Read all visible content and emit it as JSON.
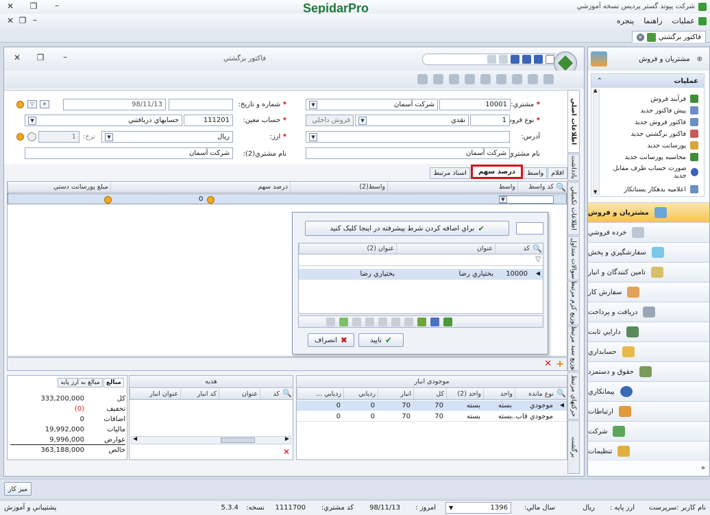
{
  "app": {
    "title": "شرکت پيوند گستر پرديس نسخه آموزشي",
    "brand": "SepidarPro",
    "brand_color": "#1d7a3a"
  },
  "menu": {
    "items": [
      "عمليات",
      "راهنما",
      "پنجره"
    ]
  },
  "doc_tab": {
    "label": "فاکتور برگشتي"
  },
  "window": {
    "title": "فاکتور برگشتي"
  },
  "form": {
    "customer": {
      "label": "مشتري:",
      "code": "10001",
      "name": "شرکت آسمان"
    },
    "number_date": {
      "label": "شماره و تاريخ:",
      "date": "98/11/13",
      "number": ""
    },
    "sale_type": {
      "label": "نوع فروش:",
      "code": "1",
      "value": "نقدي",
      "secondary": "فروش داخلي"
    },
    "account": {
      "label": "حساب معين:",
      "code": "111201",
      "name": "حسابهاي دريافتني"
    },
    "address": {
      "label": "آدرس:",
      "value": ""
    },
    "currency": {
      "label": "ارز:",
      "value": "ريال",
      "rate_label": "نرخ:",
      "rate": "1"
    },
    "customer_name": {
      "label": "نام مشتري:",
      "value": "شرکت آسمان"
    },
    "customer_name2": {
      "label": "نام مشتري(2):",
      "value": "شرکت آسمان"
    }
  },
  "vtabs": [
    "اطلاعات اصلي",
    "يادداشت",
    "اطلاعات تکميلي",
    "سوالات متداول",
    "توزيع کرم مرتبط",
    "توزيع سبد مرتبط",
    "حرکتهاي مرتبط",
    "برگشت"
  ],
  "subtabs": [
    "اقلام",
    "واسط",
    "درصد سهم",
    "اسناد مرتبط"
  ],
  "subtab_active": "درصد سهم",
  "highlight_color": "#d0141b",
  "share_grid": {
    "columns": [
      "کد واسط",
      "واسط",
      "واسط(2)",
      "درصد سهم",
      "مبلغ پورسانت دستي"
    ],
    "row": {
      "percent": "0"
    }
  },
  "popup": {
    "advanced_filter": "براي اضافه کردن شرط پيشرفته در اينجا کليک کنيد",
    "columns": [
      "کد",
      "عنوان",
      "عنوان (2)"
    ],
    "rows": [
      {
        "code": "10000",
        "title": "بختياري رضا",
        "title2": "بختياري رضا"
      }
    ],
    "ok": "تاييد",
    "cancel": "انصراف"
  },
  "stock": {
    "title": "موجودي انبار",
    "columns": [
      "نوع مانده",
      "واحد",
      "واحد (2)",
      "کل",
      "انبار",
      "رديابي",
      "رديابي ..."
    ],
    "rows": [
      {
        "type": "موجودي",
        "unit": "بسته",
        "unit2": "بسته",
        "total": "70",
        "store": "70",
        "track": "0",
        "track2": "0"
      },
      {
        "type": "موجودي قاب...",
        "unit": "بسته",
        "unit2": "بسته",
        "total": "70",
        "store": "70",
        "track": "0",
        "track2": "0"
      }
    ]
  },
  "gift": {
    "title": "هديه",
    "columns": [
      "کد",
      "عنوان",
      "کد انبار",
      "عنوان انبار"
    ]
  },
  "totals": {
    "tabs": [
      "مبالغ",
      "مبالغ به ارز پايه"
    ],
    "rows": [
      {
        "label": "کل",
        "value": "333,200,000",
        "color": "#1a1a1a"
      },
      {
        "label": "تخفيف",
        "value": "(0)",
        "color": "#d0141b"
      },
      {
        "label": "اضافات",
        "value": "0",
        "color": "#1a1a1a"
      },
      {
        "label": "ماليات",
        "value": "19,992,000",
        "color": "#1a1a1a"
      },
      {
        "label": "عوارض",
        "value": "9,996,000",
        "color": "#1a1a1a"
      },
      {
        "label": "خالص",
        "value": "363,188,000",
        "color": "#1a1a1a"
      }
    ]
  },
  "side": {
    "header": "مشتريان و فروش",
    "ops_title": "عمليات",
    "ops": [
      "فرآيند فروش",
      "پيش فاکتور جديد",
      "فاکتور فروش جديد",
      "فاکتور برگشتي جديد",
      "پورسانت جديد",
      "محاسبه پورسانت جديد",
      "صورت حساب طرف مقابل جديد",
      "اعلاميه بدهکار بستانکار"
    ],
    "nav": [
      "مشتريان و فروش",
      "خرده فروشي",
      "سفارشگيري و پخش",
      "تامين کنندگان و انبار",
      "سفارش کار",
      "دريافت و پرداخت",
      "دارايي ثابت",
      "حسابداري",
      "حقوق و دستمزد",
      "پيمانکاري",
      "ارتباطات",
      "شرکت",
      "تنظيمات"
    ],
    "nav_active": "مشتريان و فروش"
  },
  "taskbar": {
    "button": "ميز کار"
  },
  "status": {
    "user": "نام کاربر :سرپرست",
    "base_currency_label": "ارز پايه :",
    "base_currency": "ريال",
    "fiscal_year_label": "سال مالي:",
    "fiscal_year": "1396",
    "today_label": "امروز :",
    "today": "98/11/13",
    "customer_code_label": "کد مشتري:",
    "customer_code": "1111700",
    "version_label": "نسخه:",
    "version": "5.3.4",
    "support": "پشتيباني و آموزش"
  }
}
